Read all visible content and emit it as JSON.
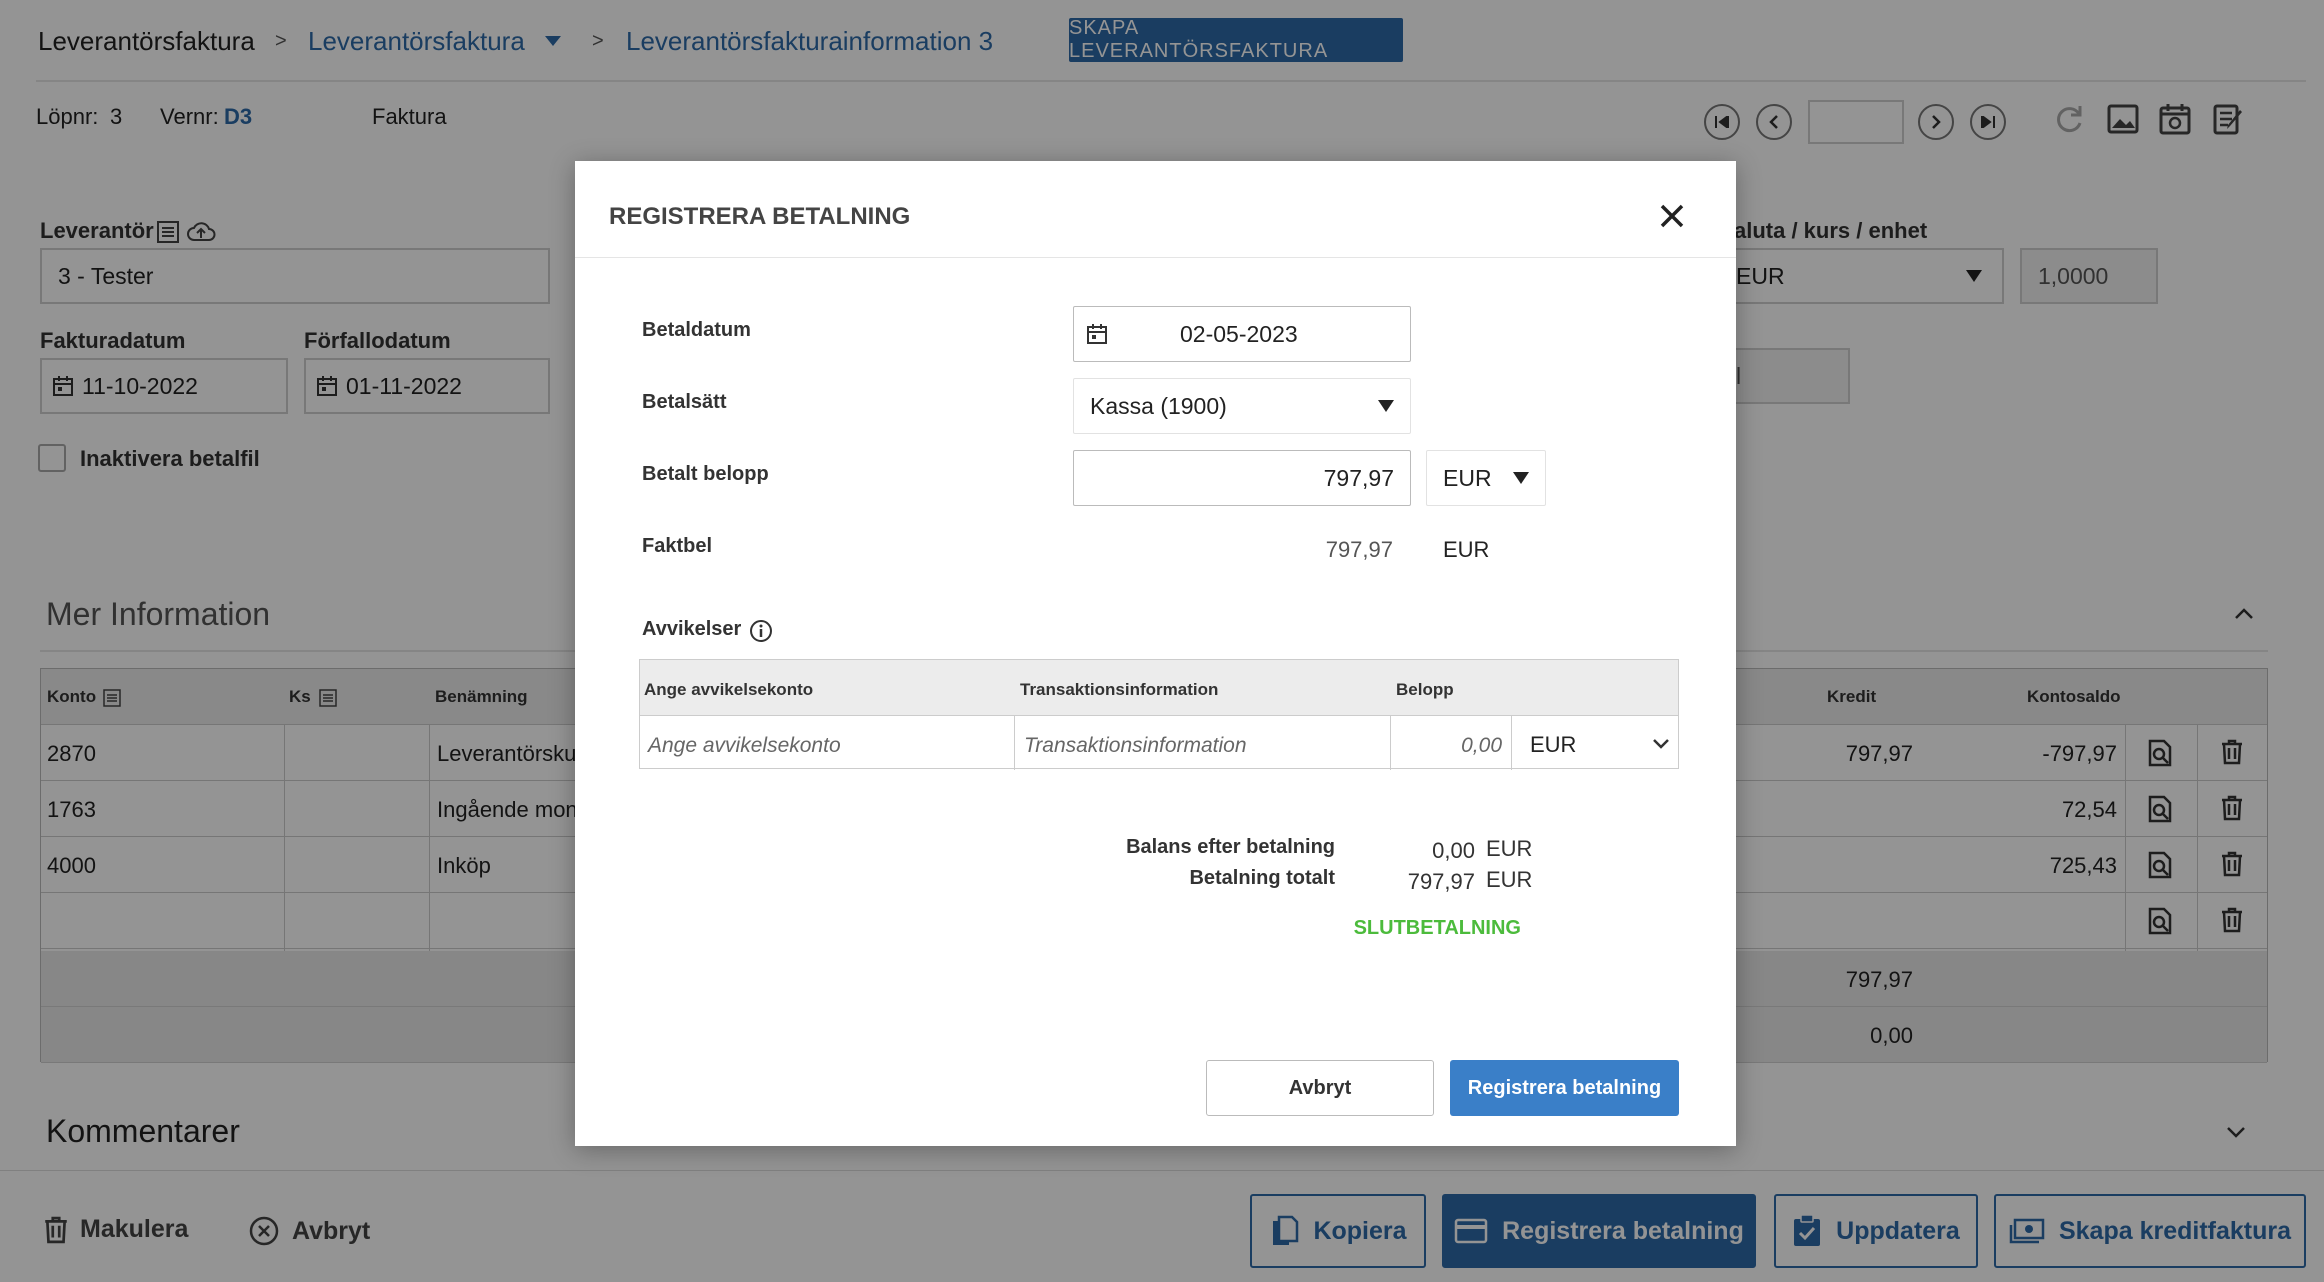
{
  "breadcrumb": {
    "root": "Leverantörsfaktura",
    "sep1": ">",
    "section": "Leverantörsfaktura",
    "sep2": ">",
    "current": "Leverantörsfakturainformation 3"
  },
  "header": {
    "create_button": "SKAPA LEVERANTÖRSFAKTURA",
    "lopnr_label": "Löpnr:",
    "lopnr_value": "3",
    "vernr_label": "Vernr:",
    "vernr_value": "D3",
    "doc_type": "Faktura"
  },
  "form": {
    "leverantor_label": "Leverantör",
    "leverantor_value": "3 - Tester",
    "fakturadatum_label": "Fakturadatum",
    "fakturadatum_value": "11-10-2022",
    "forfallodatum_label": "Förfallodatum",
    "forfallodatum_value": "01-11-2022",
    "inaktivera_label": "Inaktivera betalfil",
    "valuta_label": "aluta / kurs / enhet",
    "valuta_value": "EUR",
    "kurs_value": "1,0000",
    "partial_field_value": "l"
  },
  "mer_information": {
    "title": "Mer Information",
    "columns": {
      "konto": "Konto",
      "ks": "Ks",
      "benamning": "Benämning",
      "kredit": "Kredit",
      "kontosaldo": "Kontosaldo"
    },
    "rows": [
      {
        "konto": "2870",
        "benamning": "Leverantörsku",
        "kredit": "797,97",
        "saldo": "-797,97"
      },
      {
        "konto": "1763",
        "benamning": "Ingående mon",
        "kredit": "",
        "saldo": "72,54"
      },
      {
        "konto": "4000",
        "benamning": "Inköp",
        "kredit": "",
        "saldo": "725,43"
      },
      {
        "konto": "",
        "benamning": "",
        "kredit": "",
        "saldo": ""
      }
    ],
    "sum_kredit": "797,97",
    "sum_diff": "0,00"
  },
  "kommentarer": {
    "title": "Kommentarer"
  },
  "bottom_bar": {
    "makulera": "Makulera",
    "avbryt": "Avbryt",
    "kopiera": "Kopiera",
    "registrera": "Registrera betalning",
    "uppdatera": "Uppdatera",
    "skapa_kredit": "Skapa kreditfaktura"
  },
  "modal": {
    "title": "REGISTRERA BETALNING",
    "betaldatum_label": "Betaldatum",
    "betaldatum_value": "02-05-2023",
    "betalsatt_label": "Betalsätt",
    "betalsatt_value": "Kassa (1900)",
    "betalt_belopp_label": "Betalt belopp",
    "betalt_belopp_value": "797,97",
    "betalt_currency": "EUR",
    "faktbel_label": "Faktbel",
    "faktbel_value": "797,97",
    "faktbel_currency": "EUR",
    "avvikelser_label": "Avvikelser",
    "avv_columns": {
      "konto": "Ange avvikelsekonto",
      "trans": "Transaktionsinformation",
      "belopp": "Belopp"
    },
    "avv_placeholders": {
      "konto": "Ange avvikelsekonto",
      "trans": "Transaktionsinformation",
      "belopp": "0,00",
      "currency": "EUR"
    },
    "balans_label": "Balans efter betalning",
    "balans_value": "0,00",
    "balans_currency": "EUR",
    "totalt_label": "Betalning totalt",
    "totalt_value": "797,97",
    "totalt_currency": "EUR",
    "status": "SLUTBETALNING",
    "cancel_button": "Avbryt",
    "submit_button": "Registrera betalning"
  },
  "colors": {
    "primary": "#2d6aa8",
    "success": "#4cbb3c",
    "overlay": "rgba(0,0,0,0.42)"
  }
}
